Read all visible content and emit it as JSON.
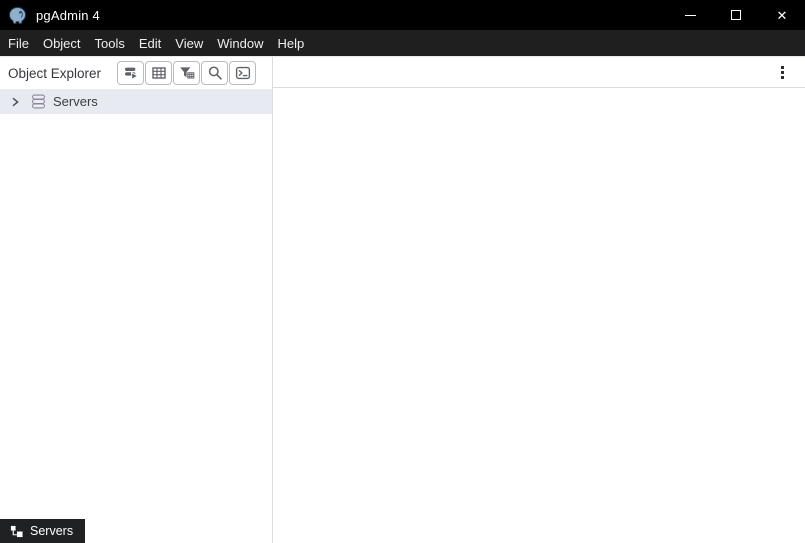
{
  "titlebar": {
    "app_title": "pgAdmin 4",
    "close_glyph": "✕",
    "icons": {
      "app": "pgadmin-logo",
      "minimize": "minimize-icon",
      "maximize": "maximize-icon",
      "close": "close-icon"
    }
  },
  "menubar": {
    "items": [
      "File",
      "Object",
      "Tools",
      "Edit",
      "View",
      "Window",
      "Help"
    ]
  },
  "object_explorer": {
    "title": "Object Explorer",
    "toolbar_icons": [
      "query-tool-icon",
      "view-data-icon",
      "filtered-rows-icon",
      "search-objects-icon",
      "psql-tool-icon"
    ],
    "tree": {
      "items": [
        {
          "label": "Servers",
          "state": "collapsed",
          "selected": true,
          "icon": "server-stack-icon"
        }
      ]
    }
  },
  "main_panel": {
    "menu_icon": "kebab-menu-icon",
    "content": ""
  },
  "bottom_bar": {
    "tabs": [
      {
        "label": "Servers",
        "icon": "tree-hierarchy-icon",
        "active": true
      }
    ]
  },
  "colors": {
    "titlebar_bg": "#000000",
    "menubar_bg": "#1f1f1f",
    "selected_row_bg": "#e7eaf0",
    "panel_border": "#d9dce1",
    "icon_gray": "#5f6368",
    "bottom_tab_bg": "#1f2123",
    "text_dark": "#35373b"
  }
}
